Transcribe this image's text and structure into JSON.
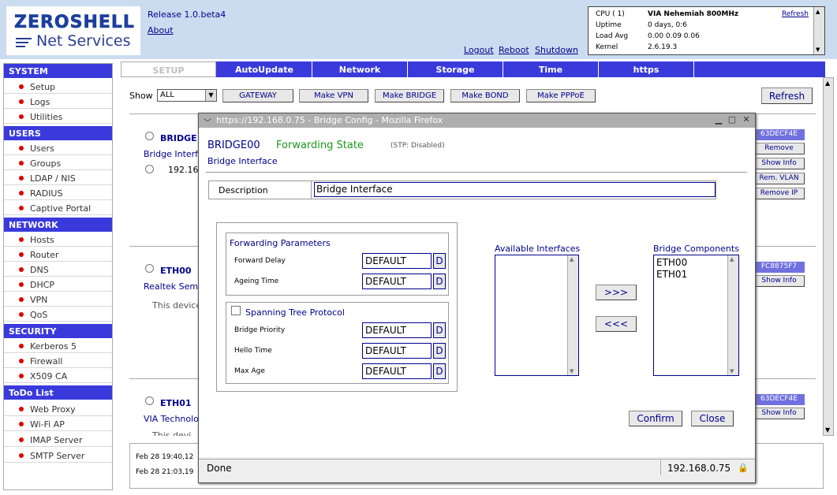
{
  "header": {
    "logo_top": "ZEROSHELL",
    "logo_bottom": "Net Services",
    "release": "Release 1.0.beta4",
    "about": "About",
    "logout": "Logout",
    "reboot": "Reboot",
    "shutdown": "Shutdown"
  },
  "sysinfo": {
    "refresh": "Refresh",
    "rows": [
      {
        "k": "CPU ( 1)",
        "v": "VIA Nehemiah 800MHz"
      },
      {
        "k": "Uptime",
        "v": "0 days, 0:6"
      },
      {
        "k": "Load Avg",
        "v": "0.00 0.09 0.06"
      },
      {
        "k": "Kernel",
        "v": "2.6.19.3"
      }
    ]
  },
  "sidebar": {
    "system": {
      "title": "SYSTEM",
      "items": [
        "Setup",
        "Logs",
        "Utilities"
      ]
    },
    "users": {
      "title": "USERS",
      "items": [
        "Users",
        "Groups",
        "LDAP / NIS",
        "RADIUS",
        "Captive Portal"
      ]
    },
    "network": {
      "title": "NETWORK",
      "items": [
        "Hosts",
        "Router",
        "DNS",
        "DHCP",
        "VPN",
        "QoS"
      ]
    },
    "security": {
      "title": "SECURITY",
      "items": [
        "Kerberos 5",
        "Firewall",
        "X509 CA"
      ]
    },
    "todo": {
      "title": "ToDo List",
      "items": [
        "Web Proxy",
        "Wi-Fi AP",
        "IMAP Server",
        "SMTP Server"
      ]
    }
  },
  "tabs": [
    "SETUP",
    "AutoUpdate",
    "Network",
    "Storage",
    "Time",
    "https"
  ],
  "toolbar": {
    "show_label": "Show",
    "show_value": "ALL",
    "buttons": [
      "GATEWAY",
      "Make VPN",
      "Make BRIDGE",
      "Make BOND",
      "Make PPPoE"
    ],
    "refresh": "Refresh"
  },
  "background": {
    "bridge_name": "BRIDGE",
    "bridge_desc": "Bridge Interfa",
    "bridge_ip": "192.16",
    "bridge_mac": "63DECF4E",
    "eth00_name": "ETH00",
    "eth00_desc": "Realtek Sem",
    "eth00_note": "This device",
    "eth00_mac": "FC8875F7",
    "eth01_name": "ETH01",
    "eth01_desc": "VIA Technolo",
    "eth01_note": "This devi",
    "eth01_mac": "63DECF4E",
    "btn_remove": "Remove",
    "btn_showinfo": "Show Info",
    "btn_remvlan": "Rem. VLAN",
    "btn_removeip": "Remove IP",
    "log1": "Feb 28 19:40,12",
    "log2": "Feb 28 21:03,19"
  },
  "popup": {
    "window_title": "https://192.168.0.75 - Bridge Config - Mozilla Firefox",
    "bridge": "BRIDGE00",
    "state": "Forwarding State",
    "stp": "(STP: Disabled)",
    "subtitle": "Bridge Interface",
    "desc_label": "Description",
    "desc_value": "Bridge Interface",
    "fwd_legend": "Forwarding Parameters",
    "forward_delay_label": "Forward Delay",
    "forward_delay": "DEFAULT",
    "ageing_label": "Ageing Time",
    "ageing": "DEFAULT",
    "stp_legend": "Spanning Tree Protocol",
    "priority_label": "Bridge Priority",
    "priority": "DEFAULT",
    "hello_label": "Hello Time",
    "hello": "DEFAULT",
    "maxage_label": "Max Age",
    "maxage": "DEFAULT",
    "d": "D",
    "available_label": "Available Interfaces",
    "components_label": "Bridge Components",
    "components": [
      "ETH00",
      "ETH01"
    ],
    "add": ">>>",
    "remove": "<<<",
    "confirm": "Confirm",
    "close": "Close",
    "status": "Done",
    "status_ip": "192.168.0.75"
  },
  "colors": {
    "accent": "#3a3adc",
    "link": "#00008b",
    "state": "#1a9a1a",
    "dot": "#dd0000"
  }
}
